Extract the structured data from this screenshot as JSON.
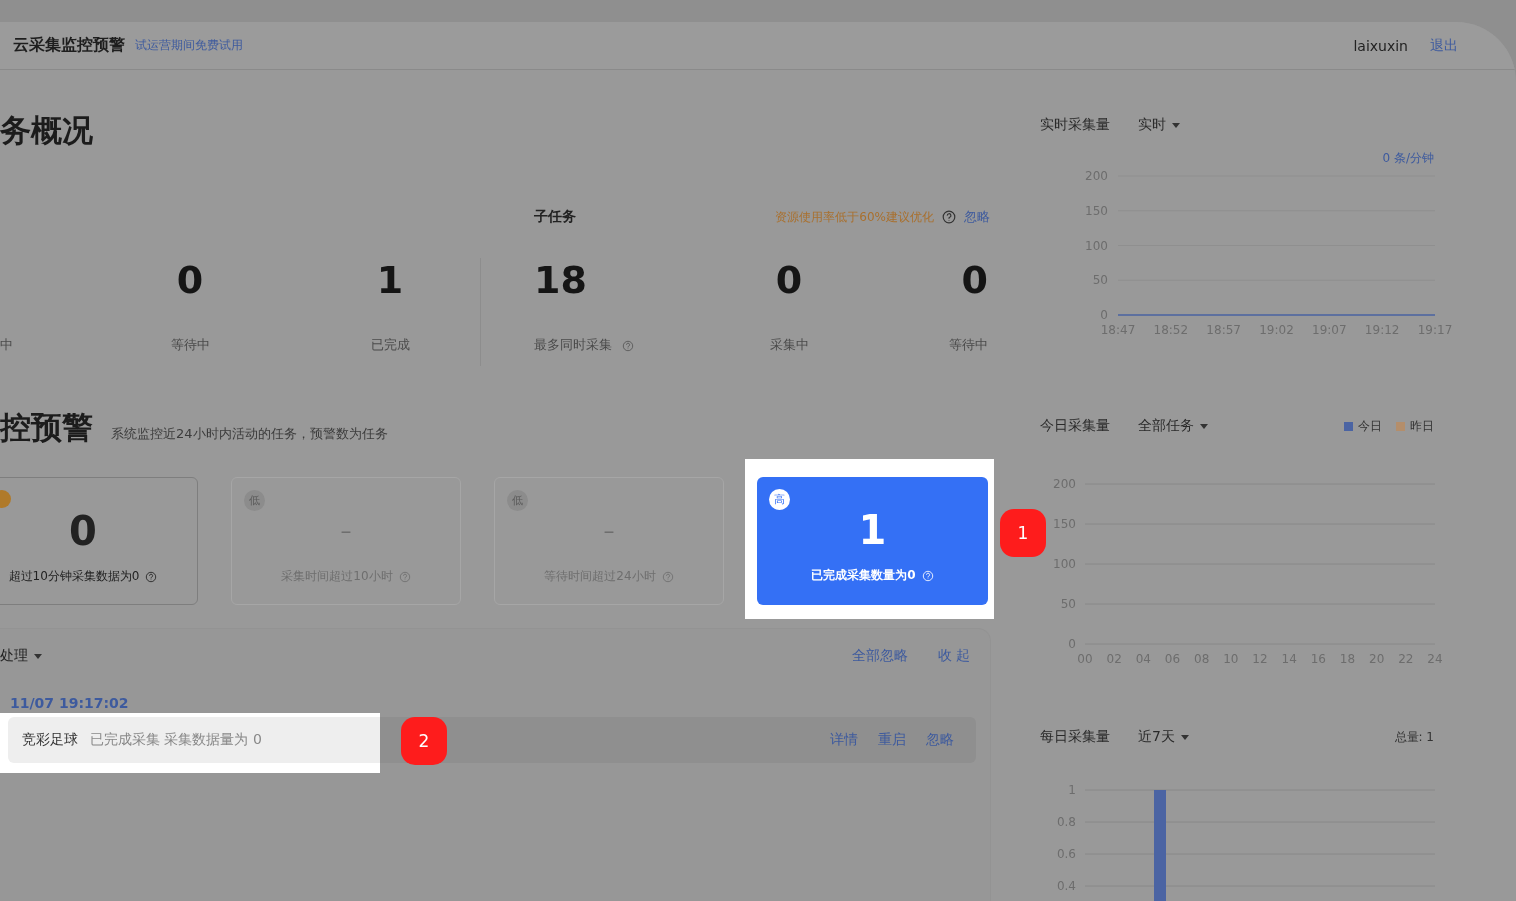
{
  "header": {
    "title": "云采集监控预警",
    "trial_note": "试运营期间免费试用",
    "user": "laixuxin",
    "logout": "退出"
  },
  "overview": {
    "title": "务概况",
    "task_stats": [
      {
        "label": "中"
      },
      {
        "value": "0",
        "label": "等待中"
      },
      {
        "value": "1",
        "label": "已完成"
      }
    ],
    "subtask_title": "子任务",
    "resource_warning": "资源使用率低于60%建议优化",
    "ignore_link": "忽略",
    "subtask_stats": [
      {
        "value": "18",
        "label": "最多同时采集",
        "help": true
      },
      {
        "value": "0",
        "label": "采集中",
        "help": false
      },
      {
        "value": "0",
        "label": "等待中",
        "help": false
      }
    ]
  },
  "monitor": {
    "title": "控预警",
    "subtitle": "系统监控近24小时内活动的任务，预警数为任务",
    "cards": [
      {
        "kind": "warning",
        "value": "0",
        "desc": "超过10分钟采集数据为0"
      },
      {
        "kind": "inactive",
        "level": "低",
        "value": "–",
        "desc": "采集时间超过10小时"
      },
      {
        "kind": "inactive",
        "level": "低",
        "value": "–",
        "desc": "等待时间超过24小时"
      },
      {
        "kind": "alert",
        "level": "高",
        "value": "1",
        "desc": "已完成采集数量为0",
        "callout": "1"
      }
    ]
  },
  "alerts": {
    "filter": "处理",
    "ignore_all": "全部忽略",
    "collapse": "收 起",
    "groups": [
      {
        "time": "11/07 19:17:02",
        "rows": [
          {
            "task": "竞彩足球",
            "message": "已完成采集 采集数据量为 0",
            "actions": [
              "详情",
              "重启",
              "忽略"
            ],
            "callout": "2"
          }
        ]
      }
    ]
  },
  "charts": [
    {
      "title": "实时采集量",
      "dropdown": "实时",
      "rate": "0 条/分钟",
      "chart_data": {
        "type": "line",
        "categories": [
          "18:47",
          "18:52",
          "18:57",
          "19:02",
          "19:07",
          "19:12",
          "19:17"
        ],
        "series": [
          {
            "color": "#4b64a3",
            "values": [
              0,
              0,
              0,
              0,
              0,
              0,
              0
            ]
          }
        ],
        "ylim": [
          0,
          200
        ],
        "yticks": [
          0,
          50,
          100,
          150,
          200
        ],
        "grid": true
      }
    },
    {
      "title": "今日采集量",
      "dropdown": "全部任务",
      "chart_data": {
        "type": "bar",
        "categories": [
          "00",
          "02",
          "04",
          "06",
          "08",
          "10",
          "12",
          "14",
          "16",
          "18",
          "20",
          "22",
          "24"
        ],
        "series": [
          {
            "name": "今日",
            "color": "#4b64a3",
            "values": [
              null,
              null,
              null,
              null,
              null,
              null,
              null,
              null,
              null,
              null,
              null,
              null,
              null
            ]
          },
          {
            "name": "昨日",
            "color": "#b48e6b",
            "values": [
              null,
              null,
              null,
              null,
              null,
              null,
              null,
              null,
              null,
              null,
              null,
              null,
              null
            ]
          }
        ],
        "ylim": [
          0,
          200
        ],
        "yticks": [
          0,
          50,
          100,
          150,
          200
        ],
        "grid": true
      }
    },
    {
      "title": "每日采集量",
      "dropdown": "近7天",
      "total": "总量: 1",
      "chart_data": {
        "type": "bar",
        "series": [
          {
            "color": "#4b64a3",
            "values": [
              0,
              1,
              0,
              0,
              0,
              0,
              0
            ]
          }
        ],
        "ylim": [
          0,
          1
        ],
        "yticks": [
          0.4,
          0.6,
          0.8,
          1
        ],
        "grid": true
      }
    }
  ]
}
